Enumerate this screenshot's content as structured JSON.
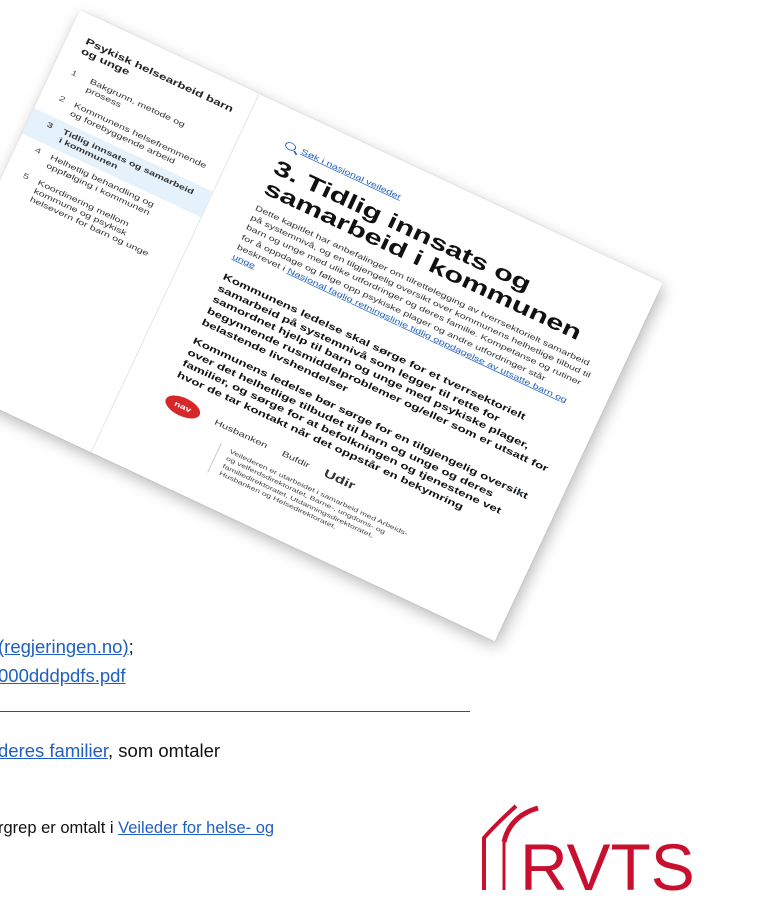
{
  "slide": {
    "line1_link": "(regjeringen.no)",
    "line1_tail": ";",
    "line2_link": "000dddpdfs.pdf",
    "line3_link": "deres familier",
    "line3_tail": ", som omtaler",
    "line4_text": "rgrep er omtalt i ",
    "line4_link": "Veileder for helse- og"
  },
  "logo": {
    "text": "RVTS",
    "color": "#c8102e"
  },
  "document": {
    "sidebar_title": "Psykisk helsearbeid barn og unge",
    "toc": [
      {
        "n": "1",
        "label": "Bakgrunn, metode og prosess"
      },
      {
        "n": "2",
        "label": "Kommunens helsefremmende og forebyggende arbeid"
      },
      {
        "n": "3",
        "label": "Tidlig innsats og samarbeid i kommunen"
      },
      {
        "n": "4",
        "label": "Helhetlig behandling og oppfølging i kommunen"
      },
      {
        "n": "5",
        "label": "Koordinering mellom kommune og psykisk helsevern for barn og unge"
      }
    ],
    "search_label": "Søk i nasjonal veileder",
    "heading": "3. Tidlig innsats og samarbeid i kommunen",
    "intro_text": "Dette kapitlet har anbefalinger om tilrettelegging av tverrsektorielt samarbeid på systemnivå, og en tilgjengelig oversikt over kommunens helhetlige tilbud til barn og unge med ulike utfordringer og deres familie. Kompetanse og rutiner for å oppdage og følge opp psykiske plager og andre utfordringer står beskrevet i ",
    "intro_link": "Nasjonal faglig retningslinje tidlig oppdagelse av utsatte barn og unge",
    "rec1": "Kommunens ledelse skal sørge for et tverrsektorielt samarbeid på systemnivå som legger til rette for samordnet hjelp til barn og unge med psykiske plager, begynnende rusmiddelproblemer og/eller som er utsatt for belastende livshendelser",
    "rec2": "Kommunens ledelse bør sørge for en tilgjengelig oversikt over det helhetlige tilbudet til barn og unge og deres familier, og sørge for at befolkningen og tjenestene vet hvor de tar kontakt når det oppstår en bekymring",
    "partners": [
      "nav",
      "Husbanken",
      "Bufdir",
      "Udir"
    ],
    "footnote": "Veilederen er utarbeidet i samarbeid med Arbeids- og velferdsdirektoratet, Barne-, ungdoms- og familiedirektoratet, Utdanningsdirektoratet, Husbanken og Helsedirektoratet."
  }
}
